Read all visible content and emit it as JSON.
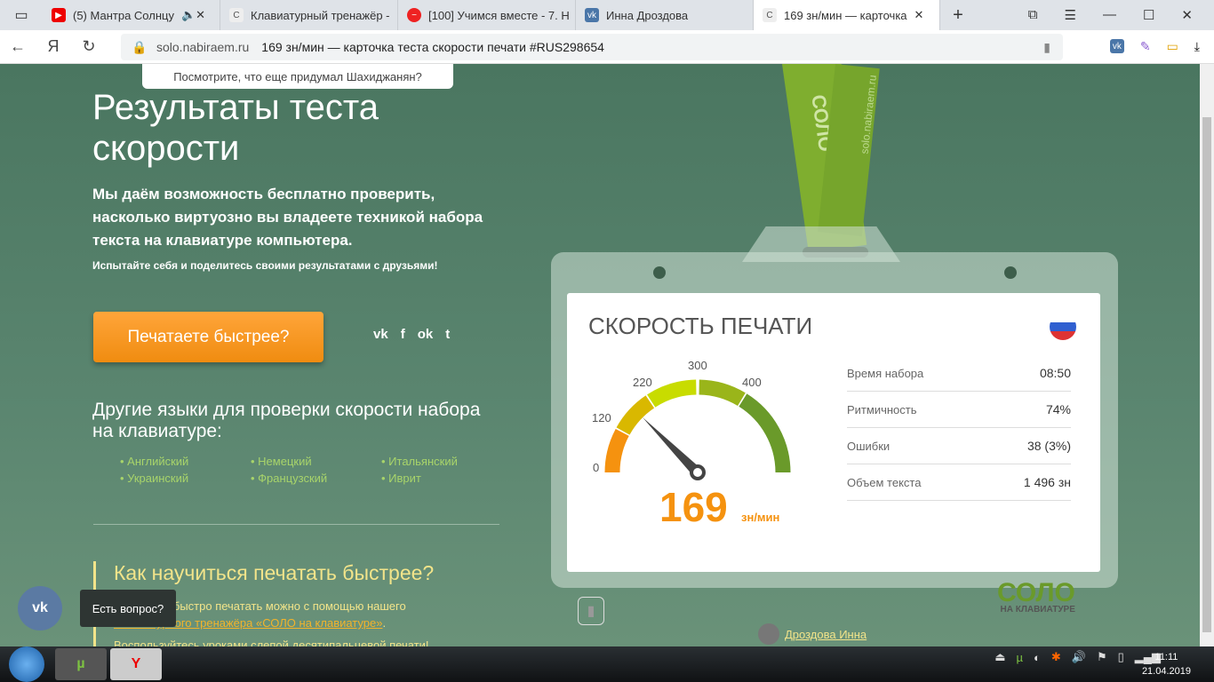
{
  "browser": {
    "tabs": [
      {
        "title": "(5) Мантра Солнцу",
        "icon": "youtube-icon"
      },
      {
        "title": "Клавиатурный тренажёр -",
        "icon": "c-icon"
      },
      {
        "title": "[100] Учимся вместе - 7. Н",
        "icon": "stop-icon"
      },
      {
        "title": "Инна Дроздова",
        "icon": "vk-icon"
      },
      {
        "title": "169 зн/мин — карточка",
        "icon": "c-icon",
        "active": true
      }
    ],
    "url_host": "solo.nabiraem.ru",
    "url_title": "169 зн/мин — карточка теста скорости печати #RUS298654",
    "yandex": "Я"
  },
  "page": {
    "tip": "Посмотрите, что еще придумал Шахиджанян?",
    "title": "Результаты теста скорости",
    "lead": "Мы даём возможность бесплатно проверить, насколько виртуозно вы владеете техникой набора текста на клавиатуре компьютера.",
    "small": "Испытайте себя и поделитесь своими результатами с друзьями!",
    "cta": "Печатаете быстрее?",
    "social": [
      "vk",
      "f",
      "ok",
      "tw"
    ],
    "other_title": "Другие языки для проверки скорости набора на клавиатуре:",
    "languages": [
      "Английский",
      "Немецкий",
      "Итальянский",
      "Украинский",
      "Французский",
      "Иврит"
    ],
    "how_title": "Как научиться печатать быстрее?",
    "how_text": "Научиться быстро печатать можно с помощью нашего",
    "how_link": "клавиатурного тренажёра «СОЛО на клавиатуре»",
    "how_text2": "Воспользуйтесь уроками слепой десятипальцевой печати!",
    "strap_text": "СОЛО",
    "strap_site": "solo.nabiraem.ru",
    "user": "Дроздова Инна",
    "vk_tooltip": "Есть вопрос?"
  },
  "card": {
    "title": "СКОРОСТЬ ПЕЧАТИ",
    "speed": "169",
    "unit": "зн/мин",
    "gauge_labels": [
      "0",
      "120",
      "220",
      "300",
      "400"
    ],
    "stats": [
      {
        "label": "Время набора",
        "value": "08:50"
      },
      {
        "label": "Ритмичность",
        "value": "74%"
      },
      {
        "label": "Ошибки",
        "value": "38 (3%)"
      },
      {
        "label": "Объем текста",
        "value": "1 496 зн"
      }
    ],
    "logo": "СОЛО",
    "logo_sub": "НА КЛАВИАТУРЕ"
  },
  "taskbar": {
    "time": "11:11",
    "date": "21.04.2019"
  }
}
